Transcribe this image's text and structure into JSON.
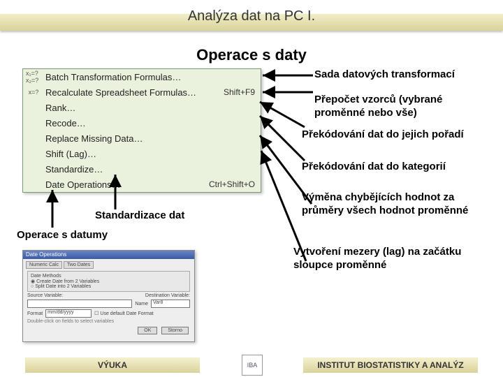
{
  "header": {
    "title": "Analýza dat na PC I."
  },
  "section_title": "Operace s daty",
  "menu": {
    "items": [
      {
        "icon": "x₁=? x₂=?",
        "label": "Batch Transformation Formulas…",
        "shortcut": ""
      },
      {
        "icon": "x=?",
        "label": "Recalculate Spreadsheet Formulas…",
        "shortcut": "Shift+F9"
      },
      {
        "icon": "",
        "label": "Rank…",
        "shortcut": ""
      },
      {
        "icon": "",
        "label": "Recode…",
        "shortcut": ""
      },
      {
        "icon": "",
        "label": "Replace Missing Data…",
        "shortcut": ""
      },
      {
        "icon": "",
        "label": "Shift (Lag)…",
        "shortcut": ""
      },
      {
        "icon": "",
        "label": "Standardize…",
        "shortcut": ""
      },
      {
        "icon": "",
        "label": "Date Operations…",
        "shortcut": "Ctrl+Shift+O"
      }
    ]
  },
  "annotations": {
    "a1": "Sada datových transformací",
    "a2": "Přepočet vzorců (vybrané proměnné nebo vše)",
    "a3": "Překódování dat do jejich pořadí",
    "a4": "Překódování dat do kategorií",
    "a5": "Výměna chybějících hodnot za průměry všech hodnot proměnné",
    "a6": "Vytvoření mezery (lag) na začátku sloupce proměnné",
    "a7": "Standardizace dat",
    "a8": "Operace s datumy"
  },
  "dialog": {
    "title": "Date Operations",
    "tab1": "Numeric Calc",
    "tab2": "Two Dates",
    "grp_title": "Date Methods",
    "opt1": "Create Date from 2 Variables",
    "opt2": "Split Date into 2 Variables",
    "lbl_src": "Source Variable:",
    "lbl_dst": "Destination Variable:",
    "lbl_name": "Name",
    "lbl_fmt": "Format",
    "val_name": "Var8",
    "val_fmt": "mm/dd/yyyy",
    "chk": "Use default Date Format",
    "hint": "Double-click on fields to select variables",
    "btn_ok": "OK",
    "btn_cancel": "Storno"
  },
  "footer": {
    "left": "VÝUKA",
    "logo": "IBA",
    "right": "INSTITUT BIOSTATISTIKY A ANALÝZ"
  }
}
